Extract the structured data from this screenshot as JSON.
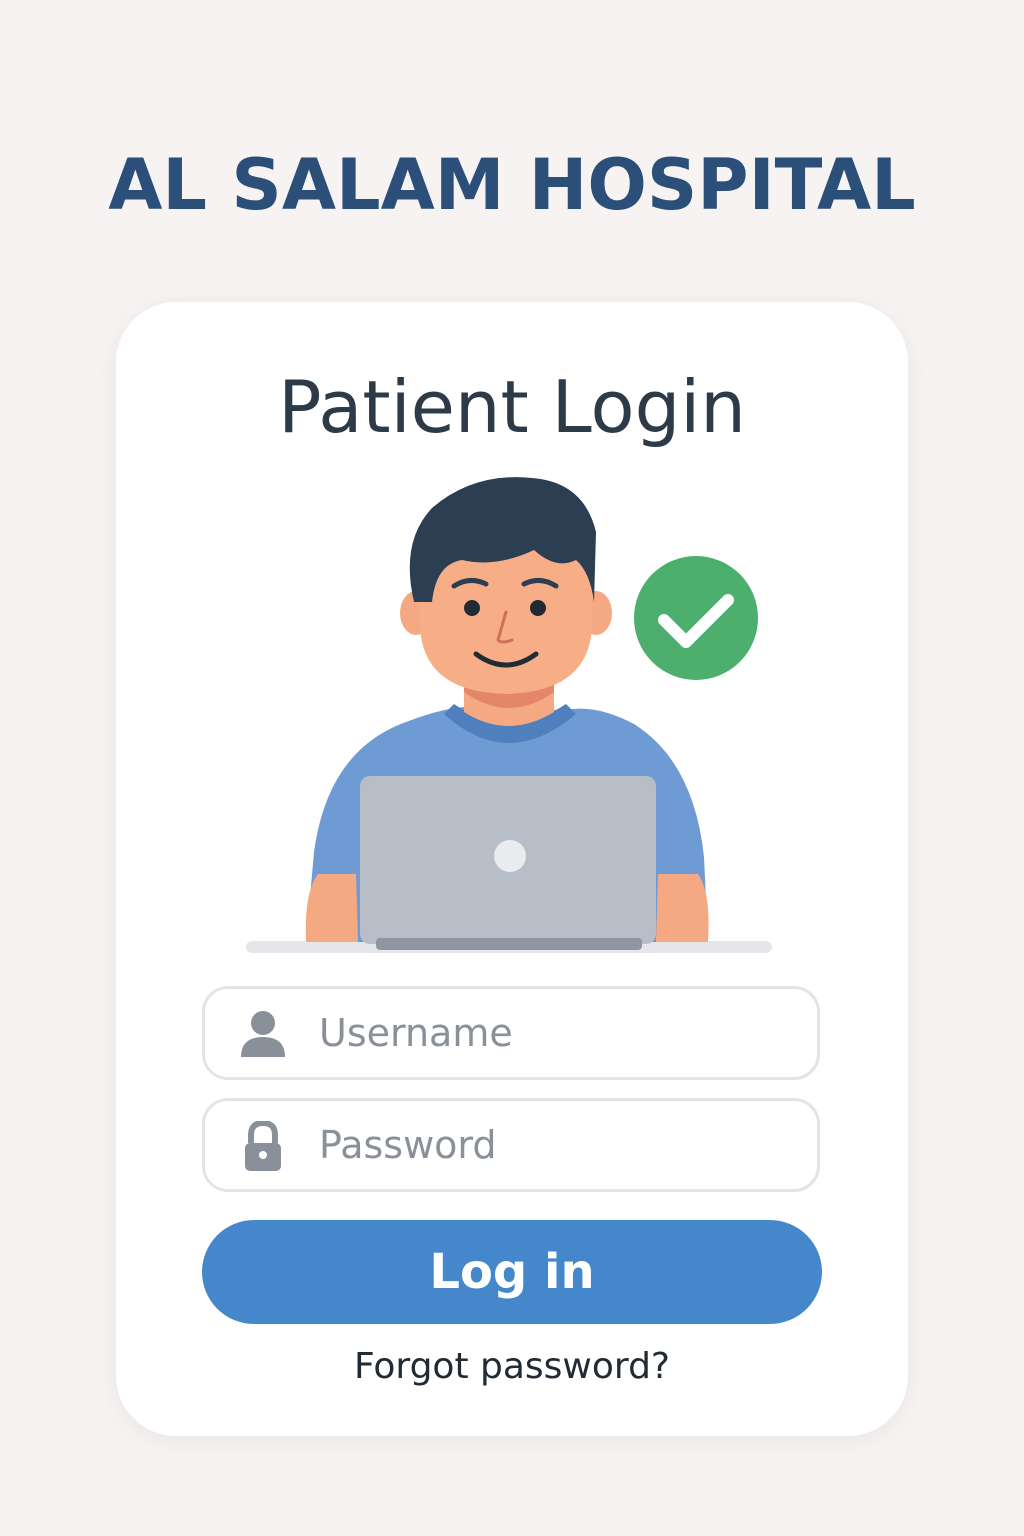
{
  "header": {
    "hospital_name": "AL SALAM HOSPITAL"
  },
  "login_card": {
    "title": "Patient Login",
    "illustration": {
      "description_icon": "patient-with-laptop-illustration",
      "badge_icon": "checkmark-icon",
      "badge_color": "#4caf6e"
    },
    "username": {
      "placeholder": "Username",
      "value": "",
      "icon": "user-icon"
    },
    "password": {
      "placeholder": "Password",
      "value": "",
      "icon": "lock-icon"
    },
    "login_button_label": "Log in",
    "forgot_password_label": "Forgot password?"
  },
  "colors": {
    "background": "#f6f3f2",
    "title": "#2b4f78",
    "accent": "#4487cb",
    "card": "#ffffff"
  }
}
